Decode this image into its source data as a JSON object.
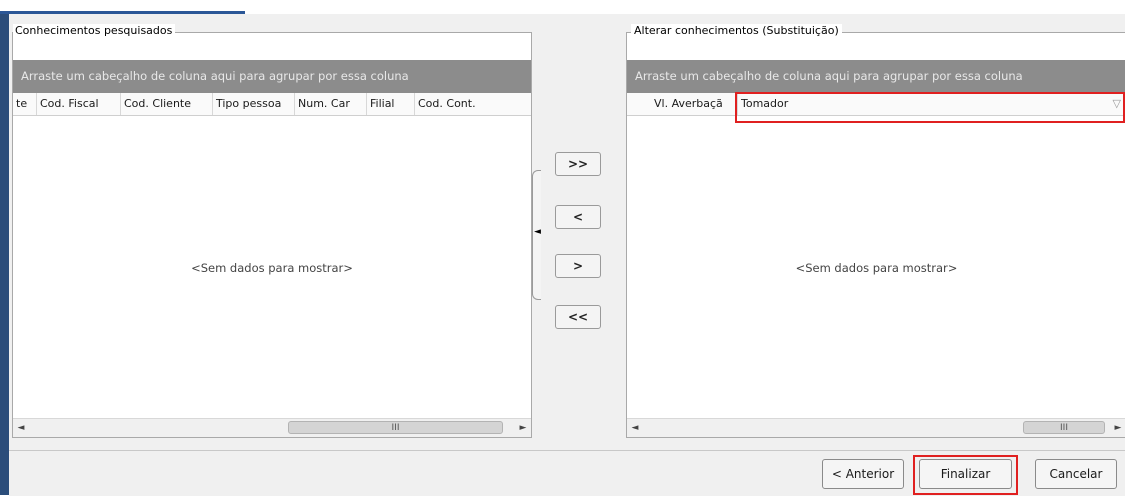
{
  "left_panel": {
    "title": "Conhecimentos pesquisados",
    "group_hint": "Arraste um cabeçalho de coluna aqui para agrupar por essa coluna",
    "columns": [
      "te",
      "Cod. Fiscal",
      "Cod. Cliente",
      "Tipo pessoa",
      "Num. Car",
      "Filial",
      "Cod. Cont."
    ],
    "empty_text": "<Sem dados para mostrar>",
    "scroll_left": "◄",
    "scroll_right": "►",
    "scroll_thumb": "III"
  },
  "right_panel": {
    "title": "Alterar conhecimentos (Substituição)",
    "group_hint": "Arraste um cabeçalho de coluna aqui para agrupar por essa coluna",
    "columns": [
      "Vl. Averbaçã",
      "Tomador"
    ],
    "filter_icon": "▽",
    "empty_text": "<Sem dados para mostrar>",
    "scroll_left": "◄",
    "scroll_right": "►",
    "scroll_thumb": "III"
  },
  "move_buttons": {
    "move_all_right": ">>",
    "move_left": "<",
    "move_right": ">",
    "move_all_left": "<<"
  },
  "splitter_arrow": "◄",
  "footer": {
    "previous": "< Anterior",
    "finish": "Finalizar",
    "cancel": "Cancelar"
  },
  "colors": {
    "highlight": "#e02020",
    "group_bar": "#8c8c8c",
    "accent": "#2b4d7a"
  }
}
